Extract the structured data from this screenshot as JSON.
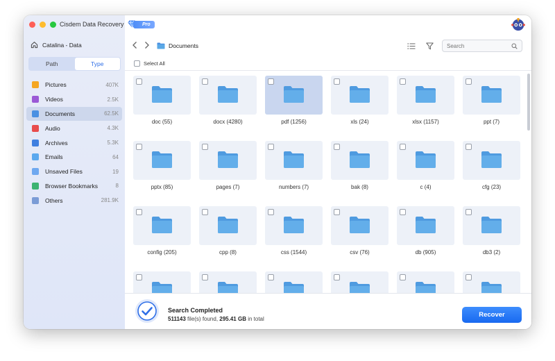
{
  "app": {
    "title": "Cisdem Data Recovery",
    "badge": "Pro"
  },
  "sidebar": {
    "drive_label": "Catalina - Data",
    "tabs": [
      {
        "label": "Path",
        "active": false
      },
      {
        "label": "Type",
        "active": true
      }
    ],
    "categories": [
      {
        "name": "Pictures",
        "count": "407K",
        "icon": "pictures-icon",
        "color": "#f5a623"
      },
      {
        "name": "Videos",
        "count": "2.5K",
        "icon": "videos-icon",
        "color": "#9b59d6"
      },
      {
        "name": "Documents",
        "count": "62.5K",
        "icon": "documents-icon",
        "color": "#4a90e2",
        "active": true
      },
      {
        "name": "Audio",
        "count": "4.3K",
        "icon": "audio-icon",
        "color": "#e84c4c"
      },
      {
        "name": "Archives",
        "count": "5.3K",
        "icon": "archives-icon",
        "color": "#3f7fe0"
      },
      {
        "name": "Emails",
        "count": "64",
        "icon": "emails-icon",
        "color": "#5aa8ee"
      },
      {
        "name": "Unsaved Files",
        "count": "19",
        "icon": "unsaved-files-icon",
        "color": "#6fa8f0"
      },
      {
        "name": "Browser Bookmarks",
        "count": "8",
        "icon": "bookmarks-icon",
        "color": "#3cb371"
      },
      {
        "name": "Others",
        "count": "281.9K",
        "icon": "others-icon",
        "color": "#7b9cd6"
      }
    ]
  },
  "toolbar": {
    "breadcrumb": "Documents",
    "search_placeholder": "Search",
    "select_all": "Select All"
  },
  "files": [
    {
      "label": "doc (55)"
    },
    {
      "label": "docx (4280)"
    },
    {
      "label": "pdf (1256)",
      "selected": true
    },
    {
      "label": "xls (24)"
    },
    {
      "label": "xlsx (1157)"
    },
    {
      "label": "ppt (7)"
    },
    {
      "label": "pptx (85)"
    },
    {
      "label": "pages (7)"
    },
    {
      "label": "numbers (7)"
    },
    {
      "label": "bak (8)"
    },
    {
      "label": "c (4)"
    },
    {
      "label": "cfg (23)"
    },
    {
      "label": "config (205)"
    },
    {
      "label": "cpp (8)"
    },
    {
      "label": "css (1544)"
    },
    {
      "label": "csv (76)"
    },
    {
      "label": "db (905)"
    },
    {
      "label": "db3 (2)"
    },
    {
      "label": ""
    },
    {
      "label": ""
    },
    {
      "label": ""
    },
    {
      "label": ""
    },
    {
      "label": ""
    },
    {
      "label": ""
    }
  ],
  "footer": {
    "status_title": "Search Completed",
    "files_count": "511143",
    "files_text": " file(s) found, ",
    "size": "295.41 GB",
    "size_suffix": " in total",
    "recover_label": "Recover"
  },
  "colors": {
    "accent": "#2f6fe7",
    "folder": "#5aa8e6",
    "tile_bg": "#edf1f8",
    "tile_selected": "#c9d6ef"
  }
}
